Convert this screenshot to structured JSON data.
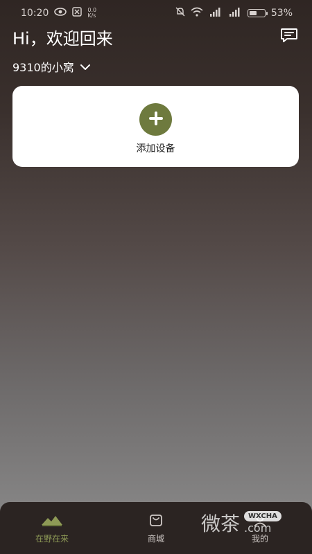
{
  "status_bar": {
    "time": "10:20",
    "net_speed_top": "0.0",
    "net_speed_bottom": "K/s",
    "battery": "53%",
    "battery_level": 0.53
  },
  "header": {
    "greeting": "Hi，欢迎回来",
    "message_icon": "message-icon"
  },
  "home": {
    "name": "9310的小窝",
    "chevron_icon": "chevron-down-icon"
  },
  "device_card": {
    "add_label": "添加设备",
    "icon": "plus-icon",
    "accent_color": "#6e7a3e"
  },
  "tab_bar": {
    "tabs": [
      {
        "label": "在野在来",
        "icon": "tent-icon",
        "active": true
      },
      {
        "label": "商城",
        "icon": "shopping-bag-icon",
        "active": false
      },
      {
        "label": "我的",
        "icon": "profile-icon",
        "active": false
      }
    ],
    "active_color": "#8e9a56"
  },
  "watermark": {
    "text": "微茶",
    "badge": "WXCHA",
    "suffix": ".com"
  }
}
